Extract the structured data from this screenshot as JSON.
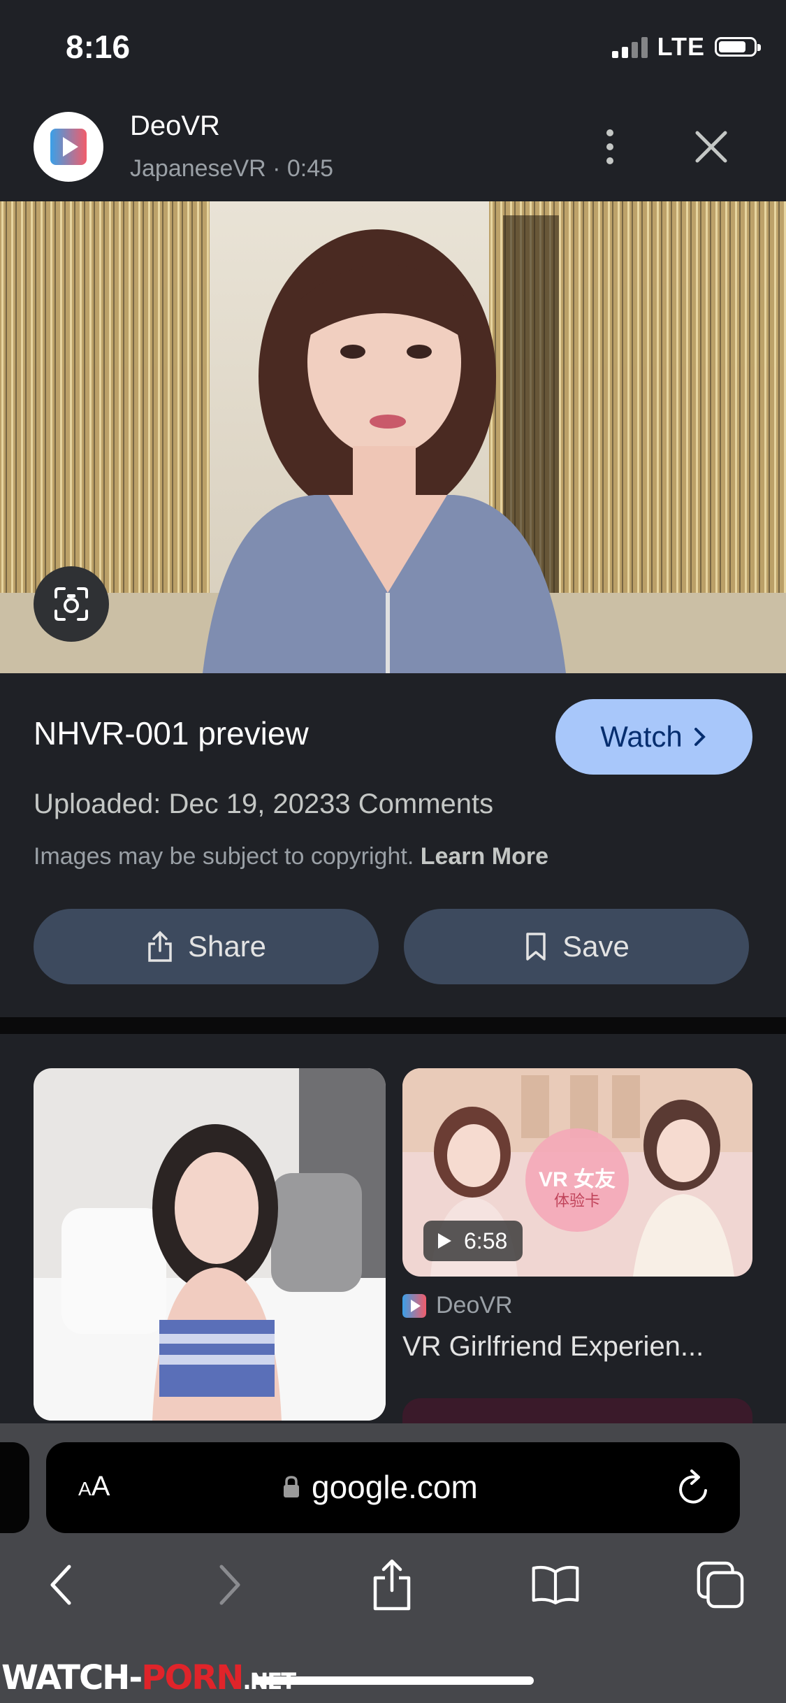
{
  "status_bar": {
    "time": "8:16",
    "network": "LTE"
  },
  "header": {
    "app_name": "DeoVR",
    "subtitle": "JapaneseVR · 0:45"
  },
  "info": {
    "title": "NHVR-001 preview",
    "watch_label": "Watch",
    "uploaded": "Uploaded: Dec 19, 20233 Comments",
    "copyright": "Images may be subject to copyright.",
    "learn_more": "Learn More",
    "share_label": "Share",
    "save_label": "Save"
  },
  "results": [
    {
      "source": "DeoVR",
      "title": "VR Girlfriend Experien...",
      "duration": "6:58",
      "thumb_text": "VR 女友",
      "thumb_subtext": "体验卡"
    }
  ],
  "browser": {
    "aa_label_small": "A",
    "aa_label_large": "A",
    "url": "google.com"
  },
  "watermark": {
    "part1": "WATCH-",
    "part2": "PORN",
    "part3": ".NET"
  },
  "colors": {
    "accent": "#a8c7fa",
    "button_bg": "#3d4a5e",
    "background": "#1f2126"
  },
  "icons": [
    "play-logo-icon",
    "more-vert-icon",
    "close-icon",
    "lens-icon",
    "chevron-right-icon",
    "share-icon",
    "bookmark-icon",
    "play-icon",
    "lock-icon",
    "reload-icon",
    "back-icon",
    "forward-icon",
    "share-sheet-icon",
    "book-icon",
    "tabs-icon"
  ]
}
